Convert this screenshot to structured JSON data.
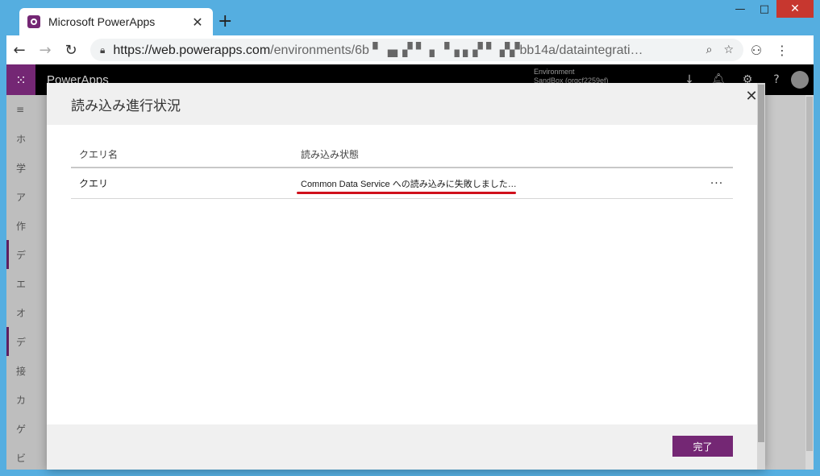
{
  "browser": {
    "tab_title": "Microsoft PowerApps",
    "new_tab": "+",
    "url_host": "https://web.powerapps.com",
    "url_path": "/environments/6b ▘▗▖▞  ▘ ▖▝▗ ▖▞ ▘ ▞▞bb14a/dataintegrati…"
  },
  "app": {
    "brand": "PowerApps",
    "environment_label": "Environment",
    "environment_value": "SandBox (orgcf2259ef)"
  },
  "leftnav": {
    "items": [
      "ホ",
      "学",
      "ア",
      "作",
      "デ",
      "エ",
      "オ",
      "デ",
      "接",
      "カ",
      "ゲ",
      "ビ"
    ]
  },
  "modal": {
    "title": "読み込み進行状況",
    "columns": [
      "クエリ名",
      "読み込み状態"
    ],
    "rows": [
      {
        "name": "クエリ",
        "status": "Common Data Service への読み込みに失敗しました…",
        "more": "···"
      }
    ],
    "done_label": "完了"
  },
  "colors": {
    "accent": "#742774",
    "error_underline": "#d0101c"
  }
}
